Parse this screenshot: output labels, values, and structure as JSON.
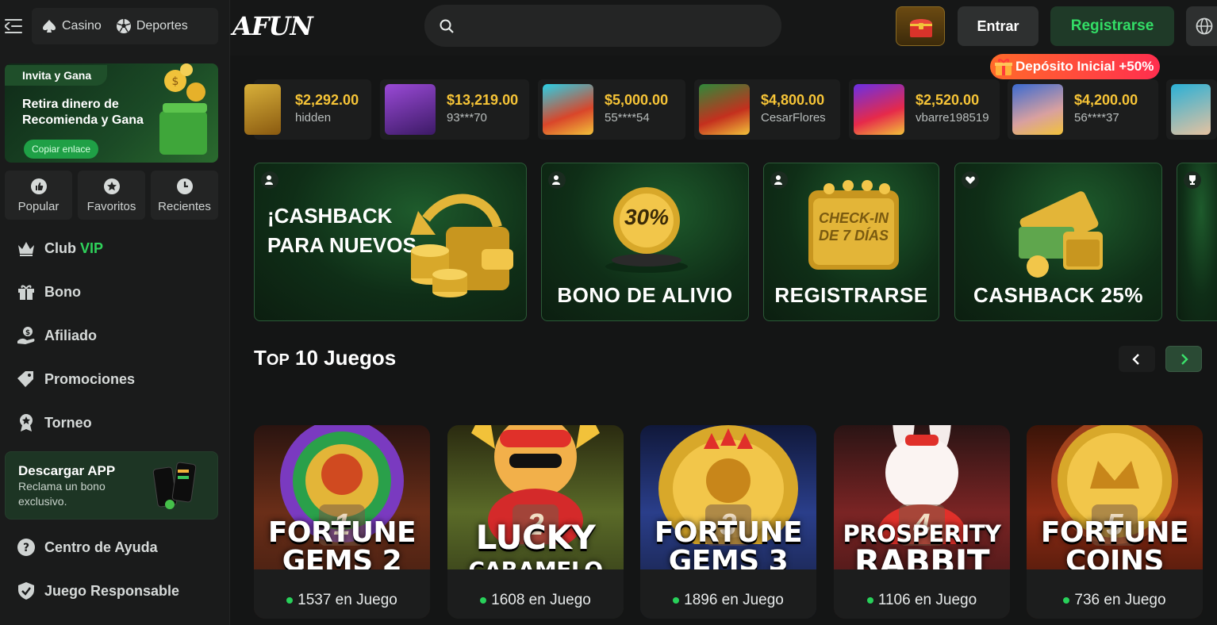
{
  "sidebar": {
    "categories": [
      {
        "label": "Casino"
      },
      {
        "label": "Deportes"
      }
    ],
    "invite": {
      "tag": "Invita y Gana",
      "title": "Retira dinero de Recomienda y Gana",
      "copy_button": "Copiar enlace"
    },
    "quick_links": [
      {
        "label": "Popular"
      },
      {
        "label": "Favoritos"
      },
      {
        "label": "Recientes"
      }
    ],
    "nav": [
      {
        "label": "Club",
        "highlight": "VIP"
      },
      {
        "label": "Bono"
      },
      {
        "label": "Afiliado"
      },
      {
        "label": "Promociones"
      },
      {
        "label": "Torneo"
      }
    ],
    "download": {
      "title": "Descargar APP",
      "subtitle": "Reclama un bono exclusivo."
    },
    "footer_nav": [
      {
        "label": "Centro de Ayuda"
      },
      {
        "label": "Juego Responsable"
      }
    ]
  },
  "header": {
    "logo": "AFUN",
    "search_placeholder": "",
    "login_label": "Entrar",
    "register_label": "Registrarse",
    "deposit_badge": "Depósito Inicial +50%"
  },
  "recent_wins": [
    {
      "amount": "$2,292.00",
      "user": "hidden",
      "thumb_color": "#c99a2a"
    },
    {
      "amount": "$13,219.00",
      "user": "93***70",
      "thumb_color": "#7a3fb8"
    },
    {
      "amount": "$5,000.00",
      "user": "55****54",
      "thumb_color": "#d94a2a"
    },
    {
      "amount": "$4,800.00",
      "user": "CesarFlores",
      "thumb_color": "#c43a1e"
    },
    {
      "amount": "$2,520.00",
      "user": "vbarre198519",
      "thumb_color": "#8a2fd6"
    },
    {
      "amount": "$4,200.00",
      "user": "56****37",
      "thumb_color": "#3a6ad1"
    }
  ],
  "promos": [
    {
      "title": "¡CASHBACK PARA NUEVOS"
    },
    {
      "title": "BONO DE ALIVIO",
      "badge": "30%"
    },
    {
      "title": "REGISTRARSE",
      "badge": "CHECK-IN DE 7 DÍAS"
    },
    {
      "title": "CASHBACK 25%"
    }
  ],
  "top_games": {
    "title_prefix": "T",
    "title_small": "OP",
    "title_rest": " 10 Juegos",
    "items": [
      {
        "rank": "1",
        "title_line1": "FORTUNE",
        "title_line2": "GEMS 2",
        "players": "1537 en Juego",
        "color": "#7a3a20"
      },
      {
        "rank": "2",
        "title_line1": "LUCKY",
        "title_line2": "CARAMELO",
        "players": "1608 en Juego",
        "color": "#5a6a30"
      },
      {
        "rank": "3",
        "title_line1": "FORTUNE",
        "title_line2": "GEMS 3",
        "players": "1896 en Juego",
        "color": "#2a3e8a"
      },
      {
        "rank": "4",
        "title_line1": "PROSPERITY",
        "title_line2": "RABBIT",
        "players": "1106 en Juego",
        "color": "#7a2424"
      },
      {
        "rank": "5",
        "title_line1": "FORTUNE",
        "title_line2": "COINS",
        "players": "736 en Juego",
        "color": "#8a2a14"
      }
    ]
  }
}
